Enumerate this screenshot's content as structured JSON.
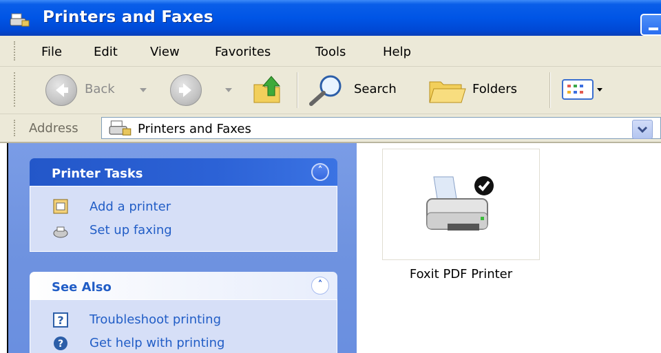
{
  "window": {
    "title": "Printers and Faxes"
  },
  "menu": {
    "items": [
      {
        "id": "file",
        "label": "File"
      },
      {
        "id": "edit",
        "label": "Edit"
      },
      {
        "id": "view",
        "label": "View"
      },
      {
        "id": "favorites",
        "label": "Favorites"
      },
      {
        "id": "tools",
        "label": "Tools"
      },
      {
        "id": "help",
        "label": "Help"
      }
    ]
  },
  "toolbar": {
    "back_label": "Back",
    "search_label": "Search",
    "folders_label": "Folders"
  },
  "address": {
    "label": "Address",
    "value": "Printers and Faxes"
  },
  "task_pane": {
    "printer_tasks": {
      "title": "Printer Tasks",
      "links": [
        {
          "label": "Add a printer",
          "icon": "add-printer-icon"
        },
        {
          "label": "Set up faxing",
          "icon": "fax-icon"
        }
      ]
    },
    "see_also": {
      "title": "See Also",
      "links": [
        {
          "label": "Troubleshoot printing",
          "icon": "help-box-icon"
        },
        {
          "label": "Get help with printing",
          "icon": "help-circle-icon"
        }
      ]
    }
  },
  "printers": [
    {
      "name": "Foxit PDF Printer",
      "is_default": true
    }
  ],
  "colors": {
    "titlebar": "#0055e6",
    "link": "#215dc6",
    "pane": "#6f93e0"
  }
}
